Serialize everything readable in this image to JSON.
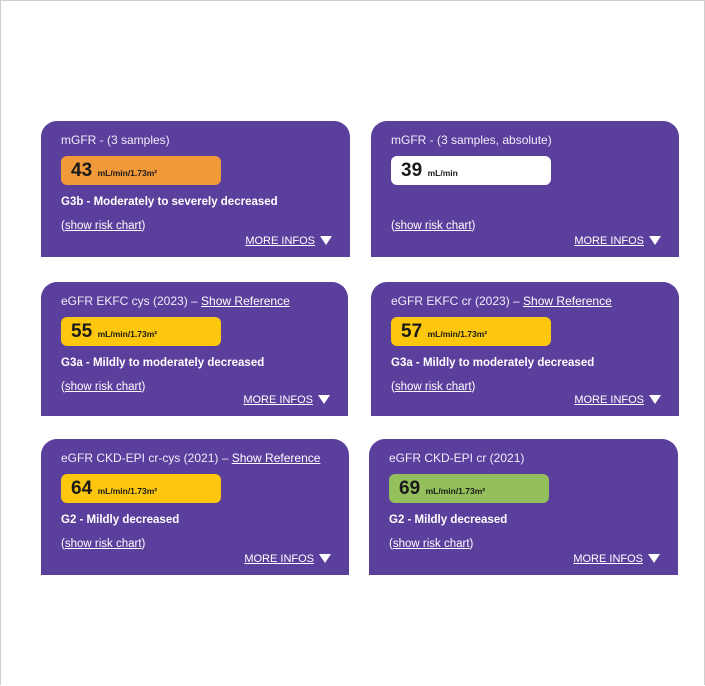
{
  "colors": {
    "card_bg": "#5b3f9c",
    "orange": "#f29a3a",
    "yellow": "#fcc70d",
    "green": "#93c05c",
    "white": "#ffffff"
  },
  "cards": [
    {
      "title": "mGFR - (3 samples)",
      "value": "43",
      "unit": "mL/min/1.73m²",
      "pill_color": "orange",
      "stage": "G3b - Moderately to severely decreased",
      "risk_open": "(",
      "risk_link": "show risk chart",
      "risk_close": ")",
      "more": "MORE INFOS",
      "more_icon": "triangle-down-icon"
    },
    {
      "title": "mGFR - (3 samples, absolute)",
      "value": "39",
      "unit": "mL/min",
      "pill_color": "white",
      "stage": "",
      "risk_open": "(",
      "risk_link": "show risk chart",
      "risk_close": ")",
      "more": "MORE INFOS",
      "more_icon": "triangle-down-icon"
    },
    {
      "title": "eGFR EKFC cys (2023) – ",
      "reference": "Show Reference",
      "value": "55",
      "unit": "mL/min/1.73m²",
      "pill_color": "yellow",
      "stage": "G3a - Mildly to moderately decreased",
      "risk_open": "(",
      "risk_link": "show risk chart",
      "risk_close": ")",
      "more": "MORE INFOS",
      "more_icon": "triangle-down-icon"
    },
    {
      "title": "eGFR EKFC cr (2023) – ",
      "reference": "Show Reference",
      "value": "57",
      "unit": "mL/min/1.73m²",
      "pill_color": "yellow",
      "stage": "G3a - Mildly to moderately decreased",
      "risk_open": "(",
      "risk_link": "show risk chart",
      "risk_close": ")",
      "more": "MORE INFOS",
      "more_icon": "triangle-down-icon"
    },
    {
      "title": "eGFR CKD-EPI cr-cys (2021) – ",
      "reference": "Show Reference",
      "value": "64",
      "unit": "mL/min/1.73m²",
      "pill_color": "yellow",
      "stage": "G2 - Mildly decreased",
      "risk_open": "(",
      "risk_link": "show risk chart",
      "risk_close": ")",
      "more": "MORE INFOS",
      "more_icon": "triangle-down-icon"
    },
    {
      "title": "eGFR CKD-EPI cr (2021)",
      "value": "69",
      "unit": "mL/min/1.73m²",
      "pill_color": "green",
      "stage": "G2 - Mildly decreased",
      "risk_open": "(",
      "risk_link": "show risk chart",
      "risk_close": ")",
      "more": "MORE INFOS",
      "more_icon": "triangle-down-icon"
    }
  ]
}
